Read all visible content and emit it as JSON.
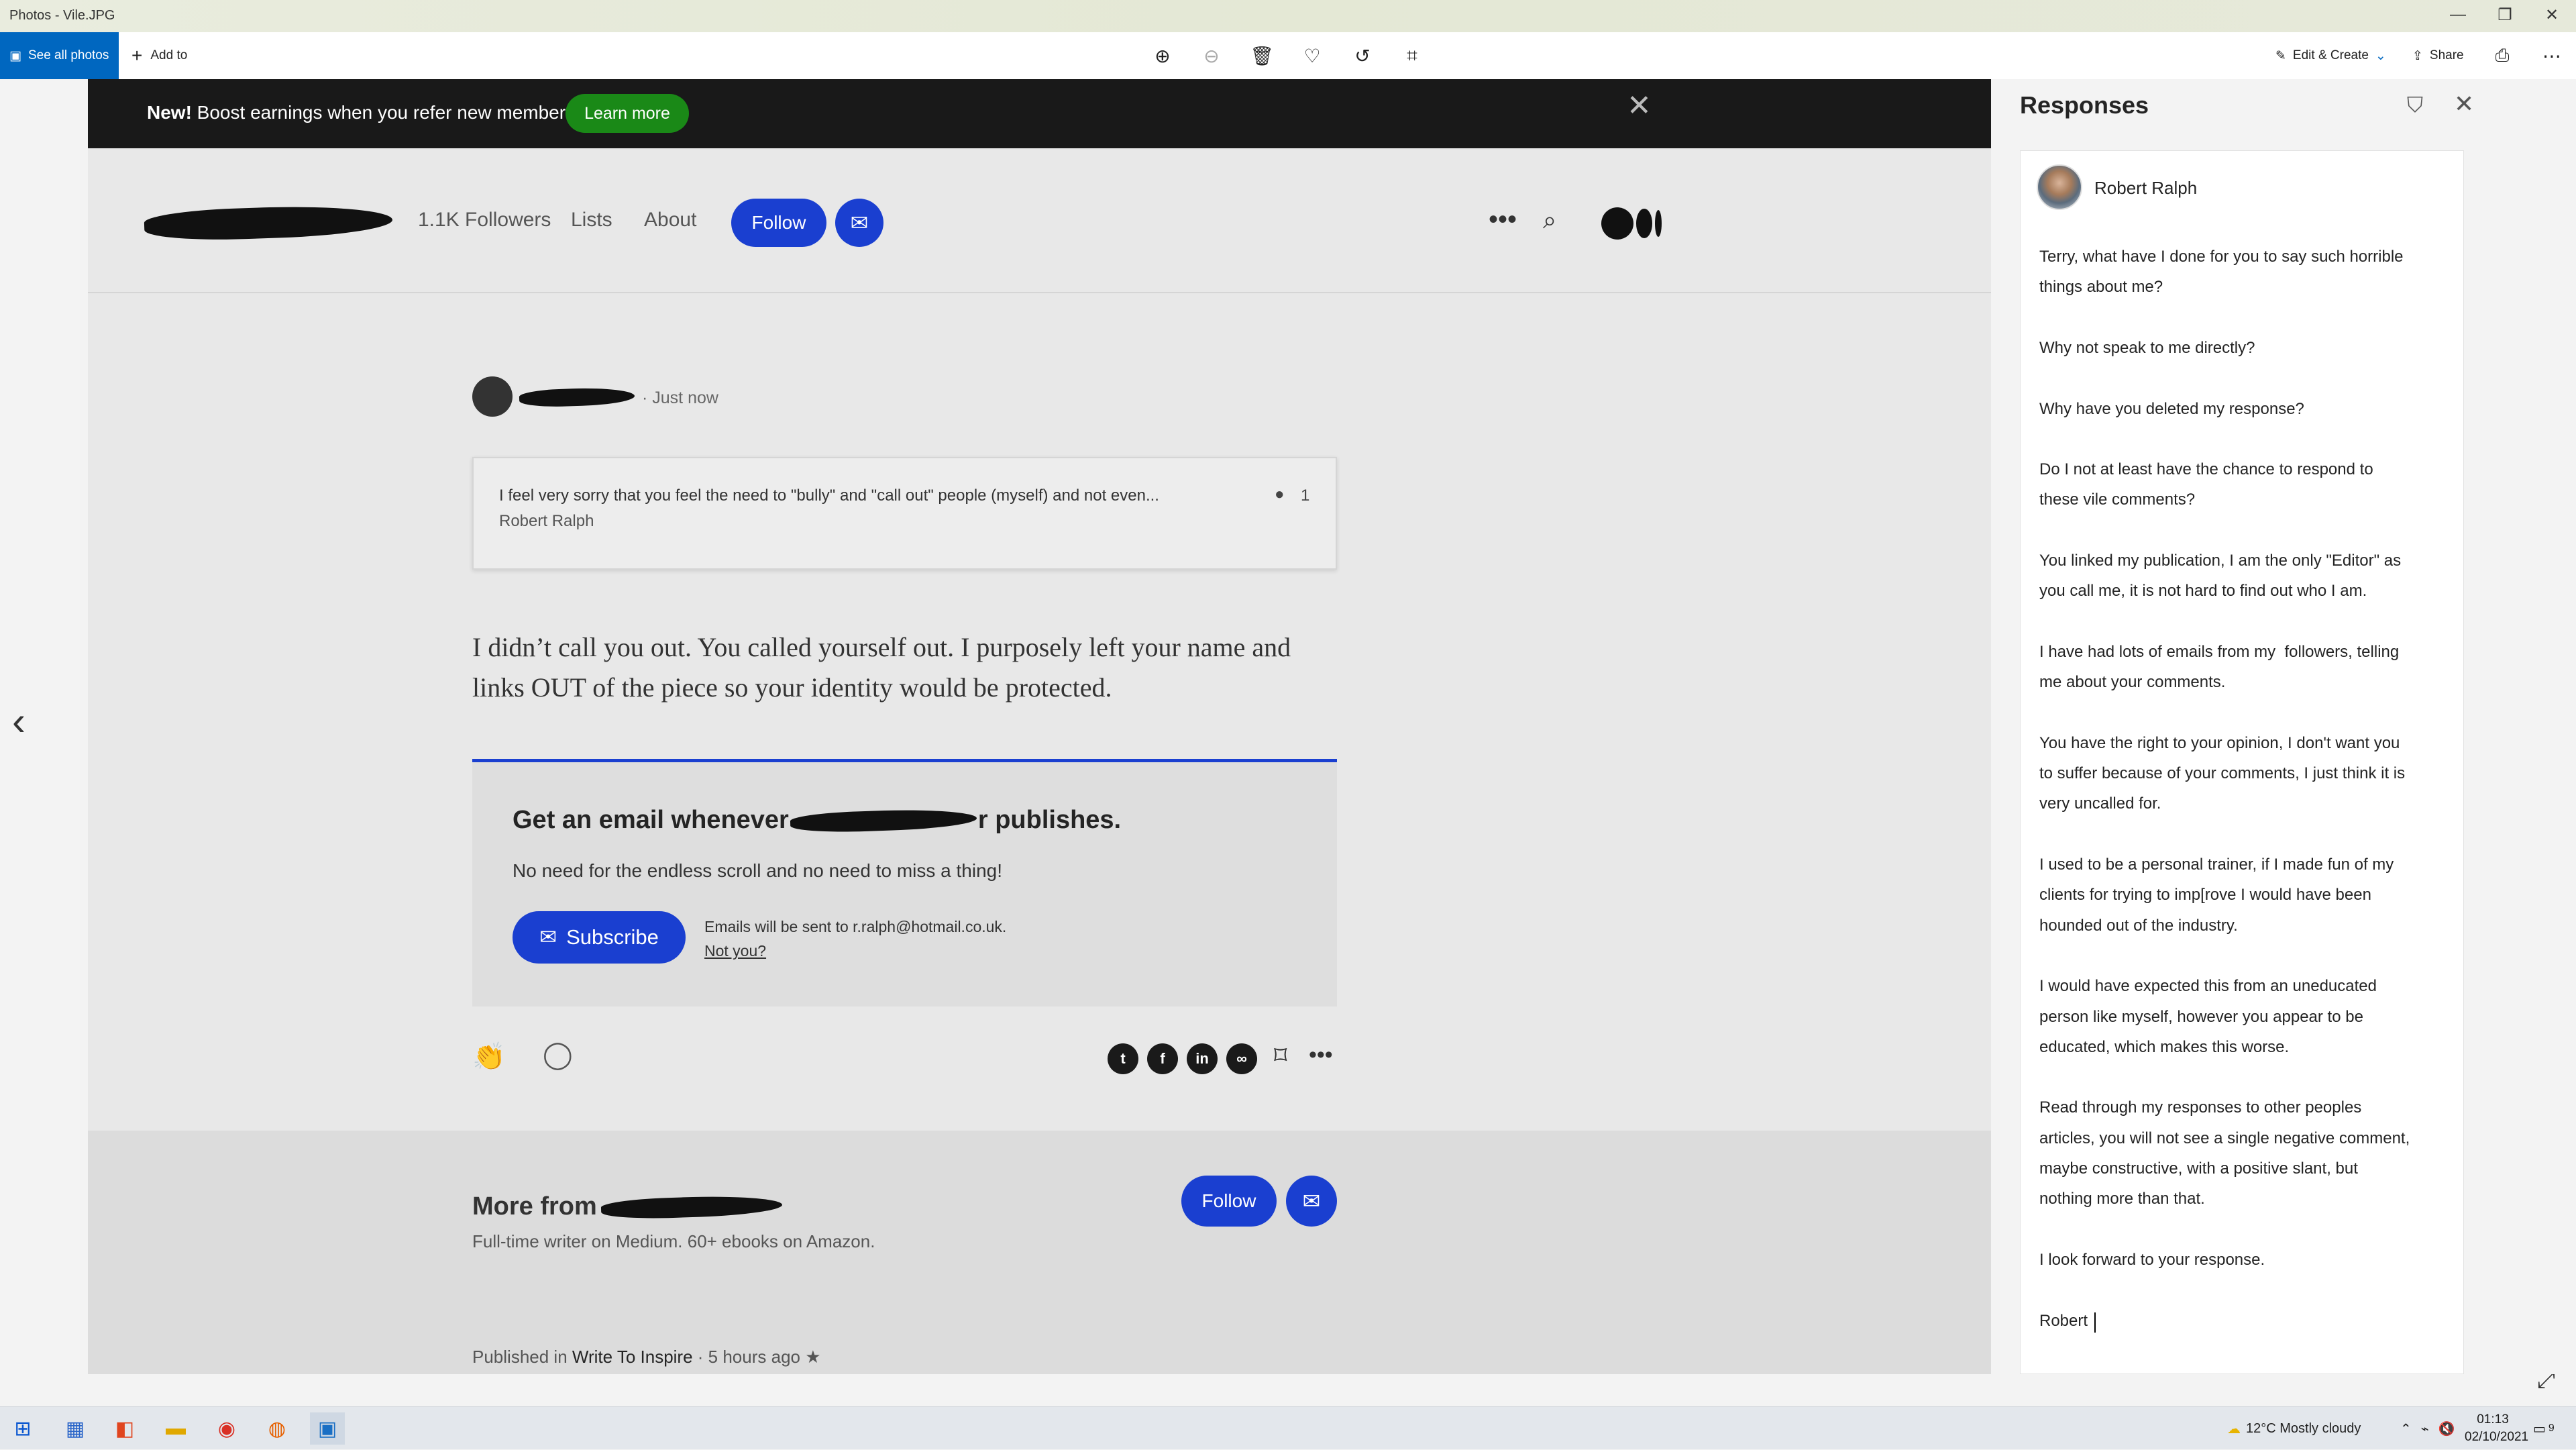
{
  "titlebar": {
    "title": "Photos - Vile.JPG",
    "minimize": "—",
    "restore": "❐",
    "close": "✕"
  },
  "toolbar": {
    "see_all": "See all photos",
    "add_to": "Add to",
    "edit_create": "Edit & Create",
    "share": "Share"
  },
  "article_page": {
    "banner": {
      "new_label": "New!",
      "text": " Boost earnings when you refer new members.",
      "learn_more": "Learn more"
    },
    "header": {
      "followers": "1.1K Followers",
      "lists": "Lists",
      "about": "About",
      "follow": "Follow"
    },
    "post": {
      "time": "· Just now",
      "quote_text": "I feel very sorry that you feel the need to \"bully\" and \"call out\" people (myself) and not even...",
      "quote_author": "Robert Ralph",
      "quote_count": "1",
      "body_line1": "I didn’t call you out. You called yourself out. I purposely left your name and",
      "body_line2": "links OUT of the piece so your identity would be protected."
    },
    "subscribe": {
      "title_start": "Get an email whenever",
      "title_end": "r publishes.",
      "subtitle": "No need for the endless scroll and no need to miss a thing!",
      "button": "Subscribe",
      "emails_to": "Emails will be sent to r.ralph@hotmail.co.uk.",
      "not_you": "Not you?"
    },
    "more": {
      "title": "More from",
      "bio": "Full-time writer on Medium. 60+ ebooks on Amazon.",
      "follow": "Follow",
      "published_prefix": "Published in ",
      "publication": "Write To Inspire",
      "published_suffix": " · 5 hours ago ★"
    }
  },
  "responses": {
    "title": "Responses",
    "author": "Robert Ralph",
    "lines": [
      "Terry, what have I done for you to say such horrible",
      "things about me?",
      "",
      "Why not speak to me directly?",
      "",
      "Why have you deleted my response?",
      "",
      "Do I not at least have the chance to respond to",
      "these vile comments?",
      "",
      "You linked my publication, I am the only \"Editor\" as",
      "you call me, it is not hard to find out who I am.",
      "",
      "I have had lots of emails from my  followers, telling",
      "me about your comments.",
      "",
      "You have the right to your opinion, I don't want you",
      "to suffer because of your comments, I just think it is",
      "very uncalled for.",
      "",
      "I used to be a personal trainer, if I made fun of my",
      "clients for trying to imp[rove I would have been",
      "hounded out of the industry.",
      "",
      "I would have expected this from an uneducated",
      "person like myself, however you appear to be",
      "educated, which makes this worse.",
      "",
      "Read through my responses to other peoples",
      "articles, you will not see a single negative comment,",
      "maybe constructive, with a positive slant, but",
      "nothing more than that.",
      "",
      "I look forward to your response.",
      "",
      "Robert"
    ]
  },
  "taskbar": {
    "weather": "12°C  Mostly cloudy",
    "time": "01:13",
    "date": "02/10/2021",
    "notif_count": "9"
  }
}
